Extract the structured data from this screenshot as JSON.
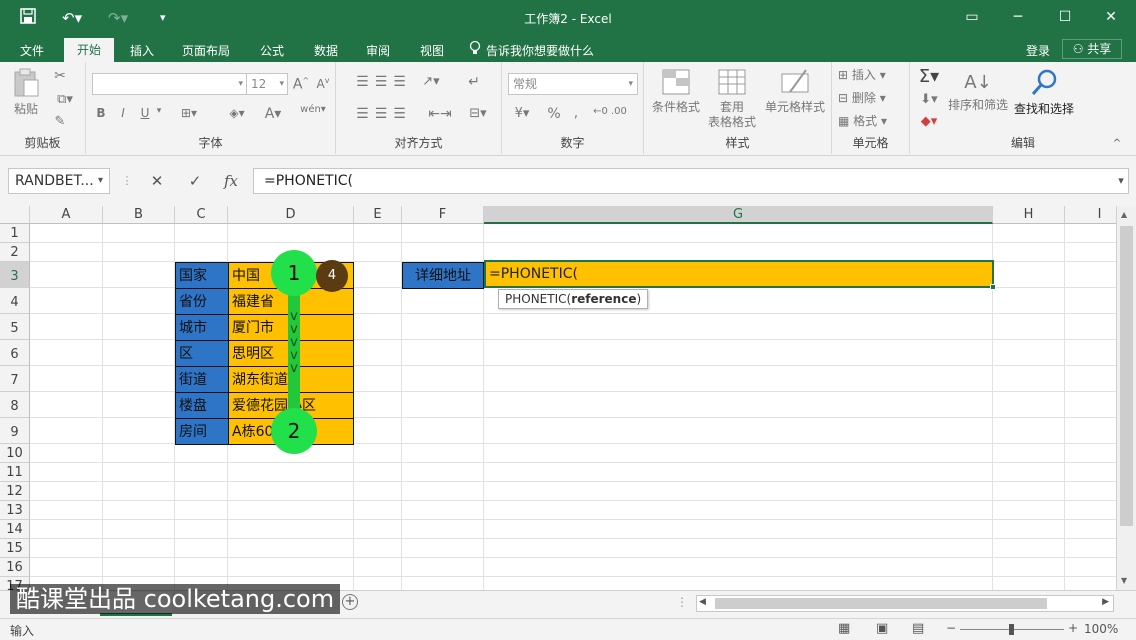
{
  "window": {
    "title": "工作簿2 - Excel",
    "buttons": [
      "▭",
      "─",
      "☐",
      "✕"
    ]
  },
  "menu": {
    "tabs": [
      "文件",
      "开始",
      "插入",
      "页面布局",
      "公式",
      "数据",
      "审阅",
      "视图"
    ],
    "tell_me": "告诉我你想要做什么",
    "login": "登录",
    "share": "共享"
  },
  "ribbon": {
    "clipboard": {
      "paste": "粘贴",
      "label": "剪贴板"
    },
    "font": {
      "size": "12",
      "bold": "B",
      "italic": "I",
      "underline": "U",
      "label": "字体"
    },
    "alignment": {
      "label": "对齐方式"
    },
    "number": {
      "format": "常规",
      "percent": "%",
      "label": "数字"
    },
    "styles": {
      "conditional": "条件格式",
      "table_line1": "套用",
      "table_line2": "表格格式",
      "cell_styles": "单元格样式",
      "label": "样式"
    },
    "cells": {
      "insert": "插入",
      "delete": "删除",
      "format": "格式",
      "label": "单元格"
    },
    "editing": {
      "sort": "排序和筛选",
      "find": "查找和选择",
      "label": "编辑"
    }
  },
  "formula_bar": {
    "name_box": "RANDBET...",
    "formula": "=PHONETIC("
  },
  "sheet": {
    "columns": [
      "A",
      "B",
      "C",
      "D",
      "E",
      "F",
      "G",
      "H",
      "I"
    ],
    "rows": [
      "1",
      "2",
      "3",
      "4",
      "5",
      "6",
      "7",
      "8",
      "9",
      "10",
      "11",
      "12",
      "13",
      "14",
      "15",
      "16",
      "17"
    ],
    "labels": [
      "国家",
      "省份",
      "城市",
      "区",
      "街道",
      "楼盘",
      "房间"
    ],
    "values": [
      "中国",
      "福建省",
      "厦门市",
      "思明区",
      "湖东街道",
      "爱德花园小区",
      "A栋605室"
    ],
    "detail_label": "详细地址",
    "active_cell_text": "=PHONETIC(",
    "tooltip_func": "PHONETIC(",
    "tooltip_arg": "reference",
    "tooltip_close": ")"
  },
  "annotations": {
    "step1": "1",
    "step2": "2",
    "badge": "4",
    "arrows": "v"
  },
  "watermark": "酷课堂出品 coolketang.com",
  "status": {
    "mode": "输入",
    "zoom": "100%"
  }
}
